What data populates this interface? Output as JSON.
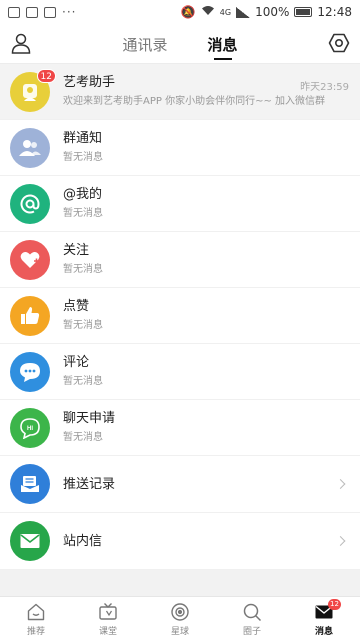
{
  "status_bar": {
    "battery": "100%",
    "time": "12:48",
    "network": "4G"
  },
  "header": {
    "tabs": [
      {
        "label": "通讯录",
        "active": false
      },
      {
        "label": "消息",
        "active": true
      }
    ]
  },
  "messages": [
    {
      "title": "艺考助手",
      "subtitle": "欢迎来到艺考助手APP 你家小助会伴你同行~~ 加入微信群",
      "time": "昨天23:59",
      "badge": "12",
      "icon": "assistant-icon",
      "color": "#e8cf3a"
    },
    {
      "title": "群通知",
      "subtitle": "暂无消息",
      "icon": "group-notice-icon",
      "color": "#9eb2d8"
    },
    {
      "title": "@我的",
      "subtitle": "暂无消息",
      "icon": "at-icon",
      "color": "#1fb37e"
    },
    {
      "title": "关注",
      "subtitle": "暂无消息",
      "icon": "heart-plus-icon",
      "color": "#ec5a5a"
    },
    {
      "title": "点赞",
      "subtitle": "暂无消息",
      "icon": "thumbs-up-icon",
      "color": "#f4a623"
    },
    {
      "title": "评论",
      "subtitle": "暂无消息",
      "icon": "comment-icon",
      "color": "#2f8fdf"
    },
    {
      "title": "聊天申请",
      "subtitle": "暂无消息",
      "icon": "chat-request-icon",
      "color": "#3cb54a"
    },
    {
      "title": "推送记录",
      "icon": "push-record-icon",
      "color": "#2f7fd9",
      "chevron": true
    },
    {
      "title": "站内信",
      "icon": "mail-icon",
      "color": "#27a64a",
      "chevron": true
    }
  ],
  "bottom_nav": [
    {
      "label": "推荐",
      "icon": "home-icon",
      "active": false
    },
    {
      "label": "课堂",
      "icon": "tv-icon",
      "active": false
    },
    {
      "label": "星球",
      "icon": "planet-icon",
      "active": false
    },
    {
      "label": "圈子",
      "icon": "search-circle-icon",
      "active": false
    },
    {
      "label": "消息",
      "icon": "message-icon",
      "active": true,
      "badge": "12"
    }
  ]
}
